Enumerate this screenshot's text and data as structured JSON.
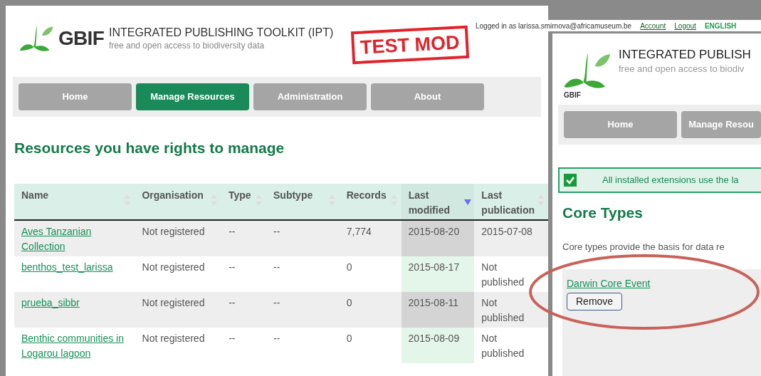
{
  "main_window": {
    "logo": "GBIF",
    "title": "INTEGRATED PUBLISHING TOOLKIT (IPT)",
    "tagline": "free and open access to biodiversity data",
    "stamp": "TEST MOD",
    "session": {
      "text": "Logged in as larissa.smirnova@africamuseum.be",
      "links": [
        "Account",
        "Logout"
      ],
      "language": "ENGLISH"
    },
    "nav": [
      {
        "label": "Home",
        "selected": false
      },
      {
        "label": "Manage Resources",
        "selected": true
      },
      {
        "label": "Administration",
        "selected": false
      },
      {
        "label": "About",
        "selected": false
      }
    ],
    "heading": "Resources you have rights to manage",
    "table": {
      "columns": [
        {
          "label": "Name",
          "sorted": false
        },
        {
          "label": "Organisation",
          "sorted": false
        },
        {
          "label": "Type",
          "sorted": false
        },
        {
          "label": "Subtype",
          "sorted": false
        },
        {
          "label": "Records",
          "sorted": false
        },
        {
          "label": "Last modified",
          "sorted": true
        },
        {
          "label": "Last publication",
          "sorted": false
        }
      ],
      "rows": [
        [
          "Aves Tanzanian Collection",
          "Not registered",
          "--",
          "--",
          "7,774",
          "2015-08-20",
          "2015-07-08"
        ],
        [
          "benthos_test_larissa",
          "Not registered",
          "--",
          "--",
          "0",
          "2015-08-17",
          "Not published"
        ],
        [
          "prueba_sibbr",
          "Not registered",
          "--",
          "--",
          "0",
          "2015-08-11",
          "Not published"
        ],
        [
          "Benthic communities in Logarou lagoon",
          "Not registered",
          "--",
          "--",
          "0",
          "2015-08-09",
          "Not published"
        ]
      ]
    }
  },
  "overlay_window": {
    "logo": "GBIF",
    "title": "INTEGRATED PUBLISH",
    "tagline": "free and open access to biodiv",
    "nav": [
      {
        "label": "Home",
        "selected": false
      },
      {
        "label": "Manage Resou",
        "selected": false
      }
    ],
    "notice": {
      "checked": true,
      "text": "All installed extensions use the la"
    },
    "heading": "Core Types",
    "description": "Core types provide the basis for data re",
    "core_type": {
      "link": "Darwin Core Event",
      "button": "Remove"
    }
  }
}
